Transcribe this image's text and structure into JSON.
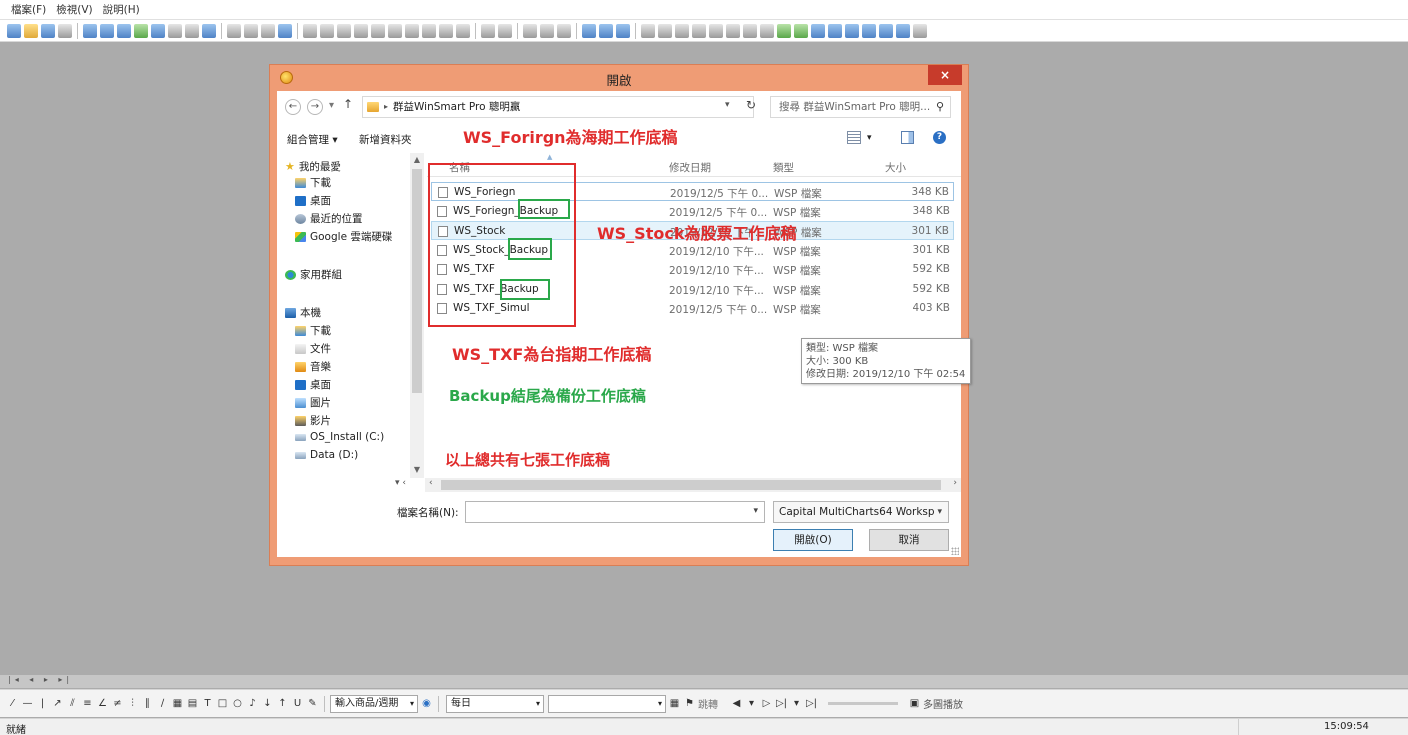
{
  "app_menu": [
    "檔案(F)",
    "檢視(V)",
    "說明(H)"
  ],
  "dialog": {
    "title": "開啟",
    "close_label": "×",
    "address": {
      "path": [
        "群益WinSmart Pro 聰明贏"
      ],
      "search_placeholder": "搜尋 群益WinSmart Pro 聰明..."
    },
    "commands": {
      "organize": "組合管理 ▾",
      "new_folder": "新增資料夾"
    },
    "nav_pane": {
      "favorites": "我的最愛",
      "favorite_items": [
        "下載",
        "桌面",
        "最近的位置",
        "Google 雲端硬碟"
      ],
      "homegroup": "家用群組",
      "this_pc": "本機",
      "pc_items": [
        "下載",
        "文件",
        "音樂",
        "桌面",
        "圖片",
        "影片",
        "OS_Install (C:)",
        "Data (D:)"
      ]
    },
    "columns": {
      "name": "名稱",
      "date": "修改日期",
      "type": "類型",
      "size": "大小"
    },
    "files": [
      {
        "name": "WS_Foriegn",
        "date": "2019/12/5 下午 0...",
        "type": "WSP 檔案",
        "size": "348 KB"
      },
      {
        "name": "WS_Foriegn_Backup",
        "date": "2019/12/5 下午 0...",
        "type": "WSP 檔案",
        "size": "348 KB"
      },
      {
        "name": "WS_Stock",
        "date": "2019/12/10 下午...",
        "type": "WSP 檔案",
        "size": "301 KB"
      },
      {
        "name": "WS_Stock_Backup",
        "date": "2019/12/10 下午...",
        "type": "WSP 檔案",
        "size": "301 KB"
      },
      {
        "name": "WS_TXF",
        "date": "2019/12/10 下午...",
        "type": "WSP 檔案",
        "size": "592 KB"
      },
      {
        "name": "WS_TXF_Backup",
        "date": "2019/12/10 下午...",
        "type": "WSP 檔案",
        "size": "592 KB"
      },
      {
        "name": "WS_TXF_Simul",
        "date": "2019/12/5 下午 0...",
        "type": "WSP 檔案",
        "size": "403 KB"
      }
    ],
    "tooltip": {
      "type": "類型: WSP 檔案",
      "size": "大小: 300 KB",
      "modified": "修改日期: 2019/12/10 下午 02:54"
    },
    "filename_label": "檔案名稱(N):",
    "filename_value": "",
    "filetype": "Capital MultiCharts64 Worksp",
    "open_button": "開啟(O)",
    "cancel_button": "取消"
  },
  "annotations": {
    "foreign": "WS_Forirgn為海期工作底稿",
    "stock": "WS_Stock為股票工作底稿",
    "txf": "WS_TXF為台指期工作底稿",
    "backup": "Backup結尾為備份工作底稿",
    "total": "以上總共有七張工作底稿",
    "backup_tag": "Backup"
  },
  "drawbar": {
    "symbol_combo": "輸入商品/週期",
    "period_combo": "每日",
    "jump_label": "跳轉",
    "multi_play": "多圖播放"
  },
  "status": {
    "left": "就緒",
    "time": "15:09:54"
  }
}
